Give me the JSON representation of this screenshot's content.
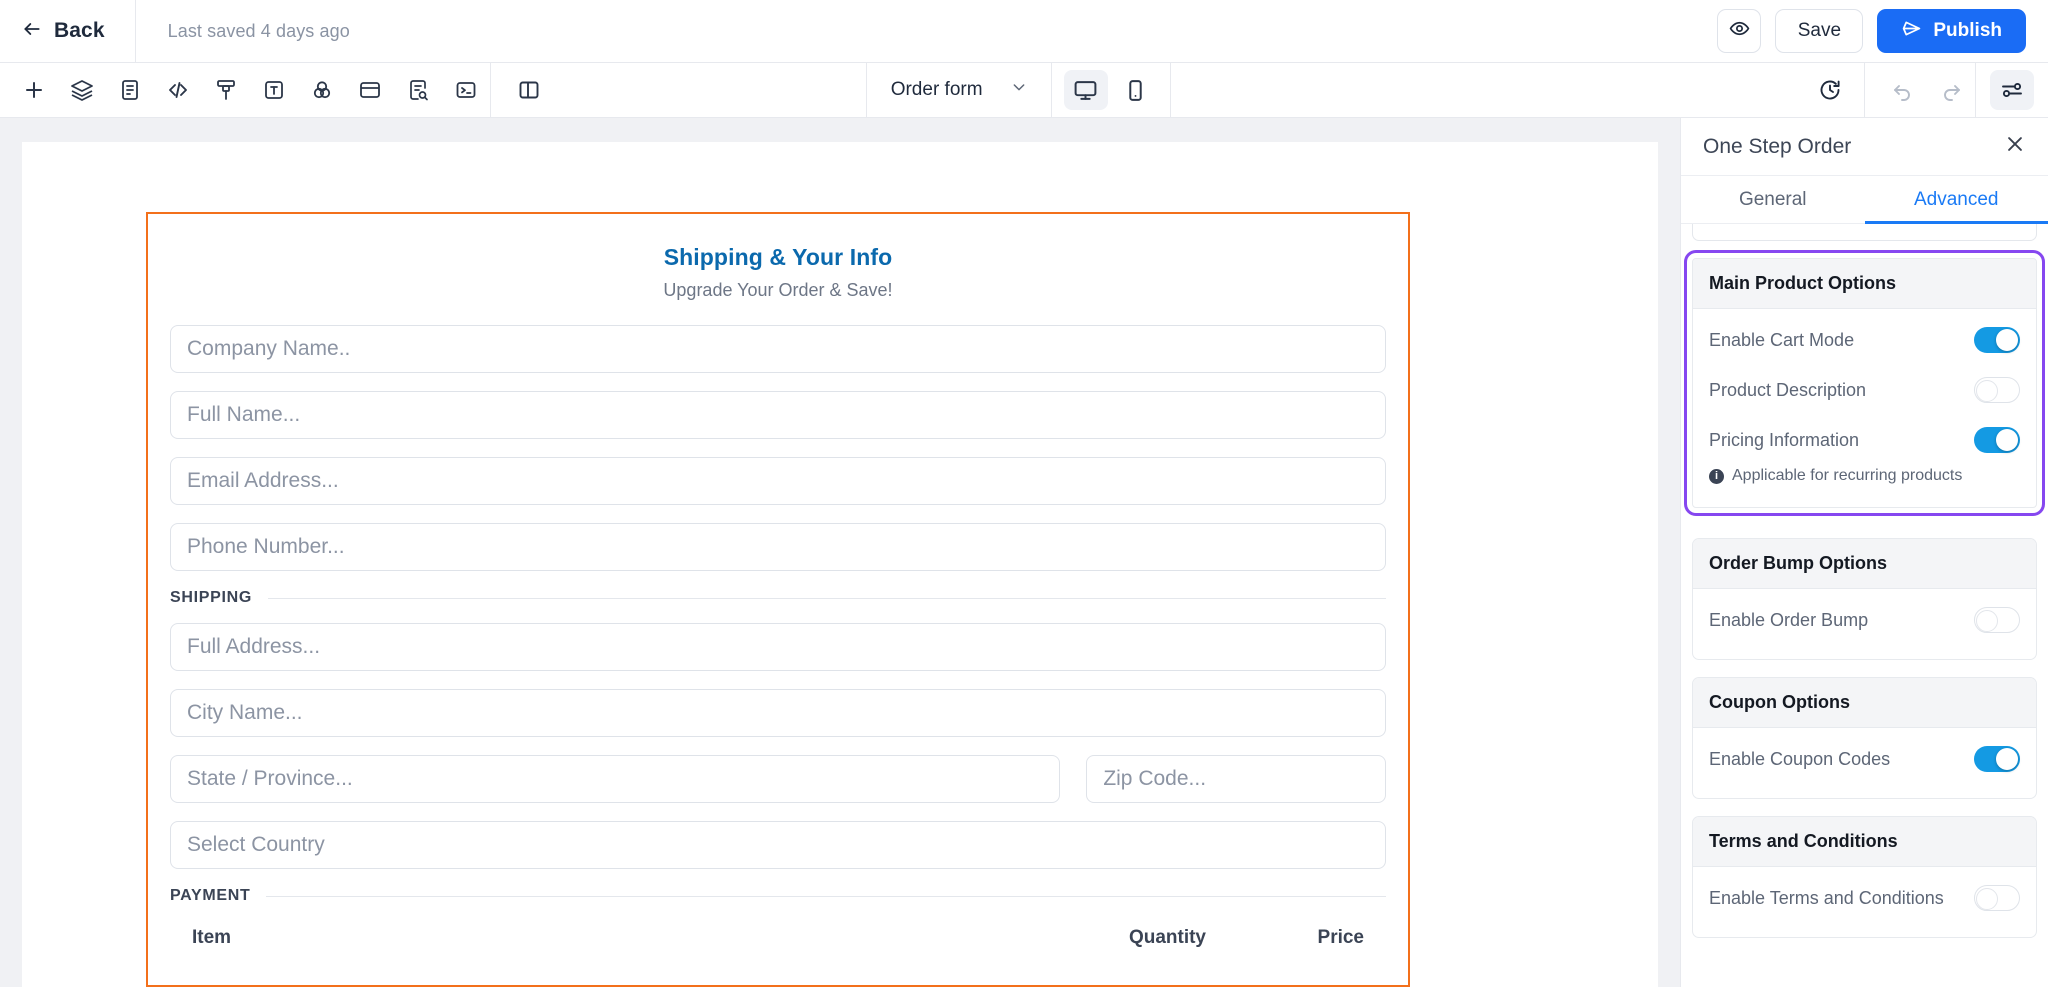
{
  "topbar": {
    "back_label": "Back",
    "last_saved": "Last saved 4 days ago",
    "preview_icon": "eye-icon",
    "save_label": "Save",
    "publish_label": "Publish",
    "publish_icon": "send-icon",
    "accent_blue": "#1a6cf5"
  },
  "toolbar": {
    "tools": [
      {
        "name": "add-element-icon",
        "glyph": "plus"
      },
      {
        "name": "layers-icon",
        "glyph": "layers"
      },
      {
        "name": "document-icon",
        "glyph": "document"
      },
      {
        "name": "code-icon",
        "glyph": "code"
      },
      {
        "name": "brush-icon",
        "glyph": "brush"
      },
      {
        "name": "text-icon",
        "glyph": "text"
      },
      {
        "name": "color-mix-icon",
        "glyph": "circles"
      },
      {
        "name": "card-icon",
        "glyph": "card"
      },
      {
        "name": "page-search-icon",
        "glyph": "page-search"
      },
      {
        "name": "terminal-icon",
        "glyph": "terminal"
      }
    ],
    "panel_toggle_icon": "split-panel-icon",
    "page_select_value": "Order form",
    "devices": [
      {
        "name": "desktop-view",
        "glyph": "desktop",
        "active": true
      },
      {
        "name": "mobile-view",
        "glyph": "mobile",
        "active": false
      }
    ],
    "history_icon": "history-icon",
    "undo_icon": "undo-icon",
    "redo_icon": "redo-icon",
    "settings_icon": "sliders-icon"
  },
  "canvas": {
    "form": {
      "accent_border": "#f3701b",
      "title": "Shipping & Your Info",
      "title_color": "#0b69ad",
      "subtitle": "Upgrade Your Order & Save!",
      "fields": [
        {
          "name": "company-name-field",
          "placeholder": "Company Name.."
        },
        {
          "name": "full-name-field",
          "placeholder": "Full Name..."
        },
        {
          "name": "email-address-field",
          "placeholder": "Email Address..."
        },
        {
          "name": "phone-number-field",
          "placeholder": "Phone Number..."
        }
      ],
      "shipping_heading": "SHIPPING",
      "shipping_fields": [
        {
          "name": "full-address-field",
          "placeholder": "Full Address..."
        },
        {
          "name": "city-name-field",
          "placeholder": "City Name..."
        }
      ],
      "state_placeholder": "State / Province...",
      "zip_placeholder": "Zip Code...",
      "country_placeholder": "Select Country",
      "payment_heading": "PAYMENT",
      "payment_table": {
        "columns": [
          "Item",
          "Quantity",
          "Price"
        ]
      }
    }
  },
  "right_panel": {
    "title": "One Step Order",
    "close_icon": "close-icon",
    "tabs": [
      {
        "name": "tab-general",
        "label": "General",
        "active": false
      },
      {
        "name": "tab-advanced",
        "label": "Advanced",
        "active": true
      }
    ],
    "selection_color": "#8647f0",
    "toggle_on_color": "#149ae3",
    "sections": [
      {
        "name": "main-product-options",
        "heading": "Main Product Options",
        "selected": true,
        "options": [
          {
            "name": "enable-cart-mode-toggle",
            "label": "Enable Cart Mode",
            "on": true
          },
          {
            "name": "product-description-toggle",
            "label": "Product Description",
            "on": false
          },
          {
            "name": "pricing-information-toggle",
            "label": "Pricing Information",
            "on": true
          }
        ],
        "note": "Applicable for recurring products"
      },
      {
        "name": "order-bump-options",
        "heading": "Order Bump Options",
        "selected": false,
        "options": [
          {
            "name": "enable-order-bump-toggle",
            "label": "Enable Order Bump",
            "on": false
          }
        ],
        "note": ""
      },
      {
        "name": "coupon-options",
        "heading": "Coupon Options",
        "selected": false,
        "options": [
          {
            "name": "enable-coupon-codes-toggle",
            "label": "Enable Coupon Codes",
            "on": true
          }
        ],
        "note": ""
      },
      {
        "name": "terms-and-conditions",
        "heading": "Terms and Conditions",
        "selected": false,
        "options": [
          {
            "name": "enable-terms-and-conditions-toggle",
            "label": "Enable Terms and Conditions",
            "on": false
          }
        ],
        "note": ""
      }
    ]
  }
}
